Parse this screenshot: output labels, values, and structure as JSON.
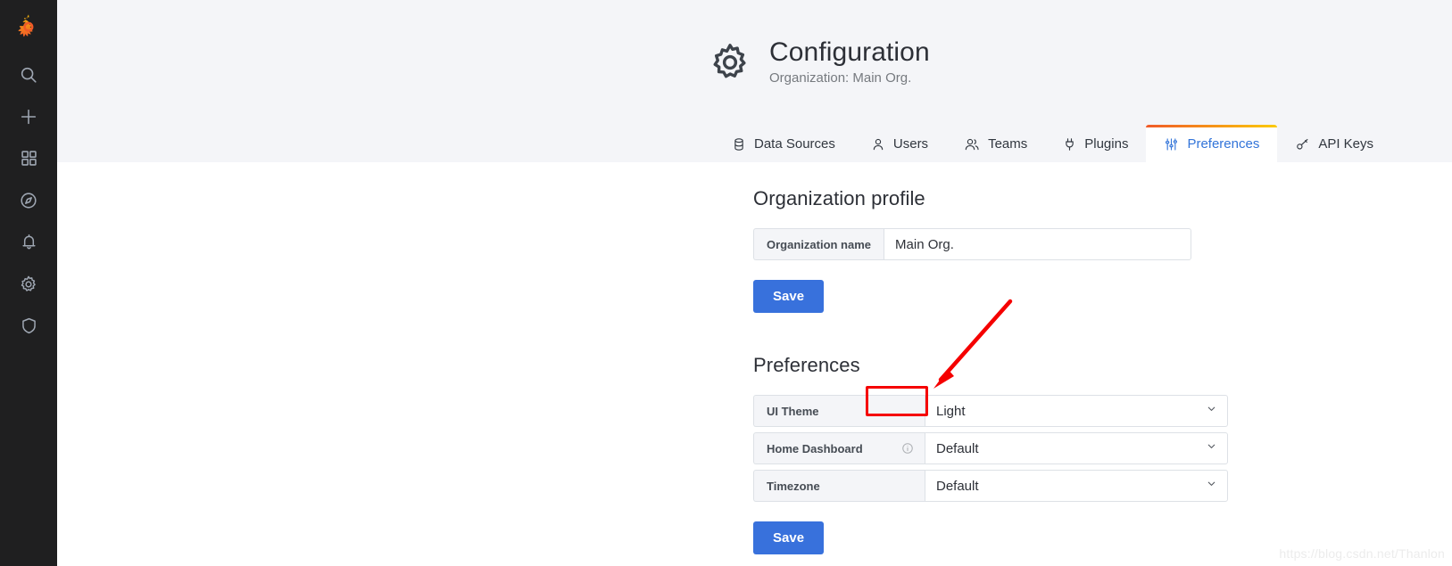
{
  "sidebar": {
    "logo": "grafana-logo",
    "items": [
      {
        "icon": "search-icon",
        "label": "Search"
      },
      {
        "icon": "plus-icon",
        "label": "Create"
      },
      {
        "icon": "dashboards-icon",
        "label": "Dashboards"
      },
      {
        "icon": "explore-icon",
        "label": "Explore"
      },
      {
        "icon": "bell-icon",
        "label": "Alerting"
      },
      {
        "icon": "gear-icon",
        "label": "Configuration"
      },
      {
        "icon": "shield-icon",
        "label": "Server Admin"
      }
    ]
  },
  "header": {
    "icon": "gear-icon",
    "title": "Configuration",
    "subtitle": "Organization: Main Org."
  },
  "tabs": [
    {
      "icon": "database-icon",
      "label": "Data Sources",
      "active": false
    },
    {
      "icon": "user-icon",
      "label": "Users",
      "active": false
    },
    {
      "icon": "users-icon",
      "label": "Teams",
      "active": false
    },
    {
      "icon": "plug-icon",
      "label": "Plugins",
      "active": false
    },
    {
      "icon": "sliders-icon",
      "label": "Preferences",
      "active": true
    },
    {
      "icon": "key-icon",
      "label": "API Keys",
      "active": false
    }
  ],
  "org_profile": {
    "heading": "Organization profile",
    "name_label": "Organization name",
    "name_value": "Main Org.",
    "name_placeholder": "",
    "save_label": "Save"
  },
  "preferences": {
    "heading": "Preferences",
    "rows": [
      {
        "label": "UI Theme",
        "value": "Light",
        "has_info": false
      },
      {
        "label": "Home Dashboard",
        "value": "Default",
        "has_info": true
      },
      {
        "label": "Timezone",
        "value": "Default",
        "has_info": false
      }
    ],
    "save_label": "Save"
  },
  "annotation": {
    "highlight_target": "UI Theme value",
    "arrow_color": "#f50000",
    "box_color": "#f50000"
  },
  "watermark": "https://blog.csdn.net/Thanlon",
  "colors": {
    "sidebar_bg": "#1f1f20",
    "page_bg": "#f4f5f8",
    "content_bg": "#ffffff",
    "primary_button": "#3871dc",
    "active_tab_text": "#3274d9",
    "tab_accent_start": "#f05a28",
    "tab_accent_end": "#fbca0a"
  }
}
